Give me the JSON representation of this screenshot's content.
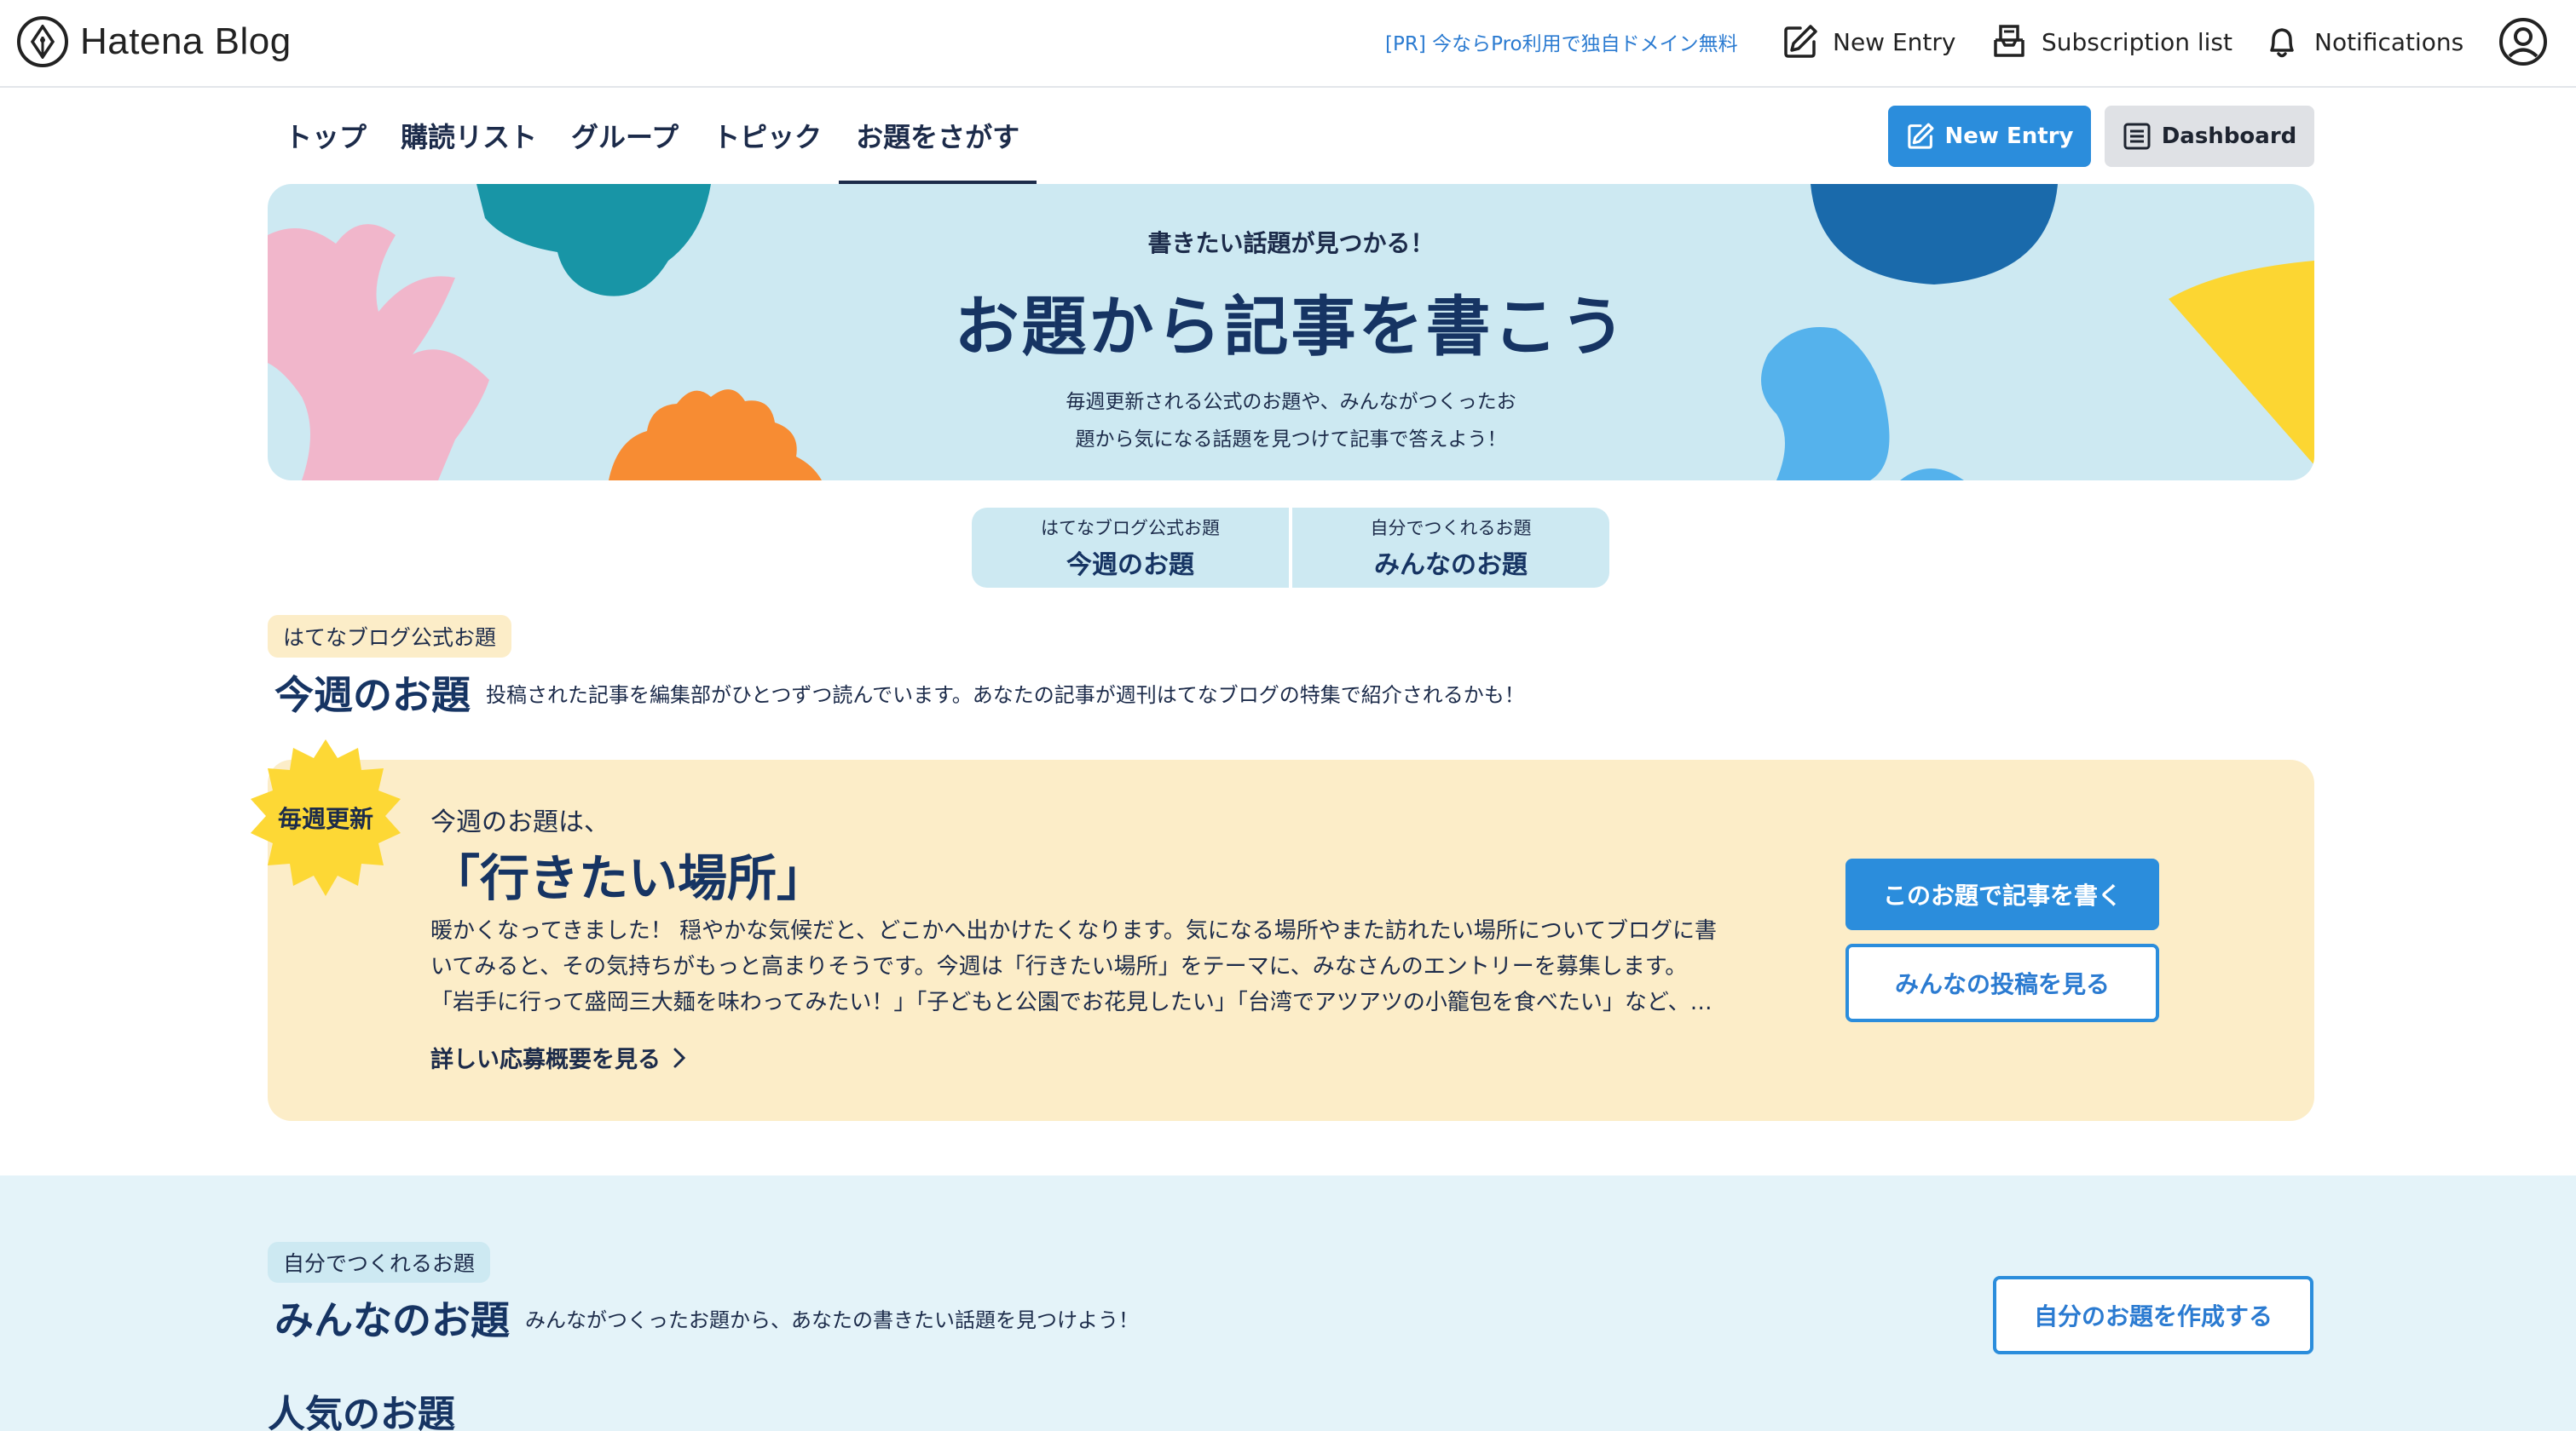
{
  "header": {
    "logo_text": "Hatena Blog",
    "pr_link": "[PR] 今ならPro利用で独自ドメイン無料",
    "new_entry": "New Entry",
    "subscription_list": "Subscription list",
    "notifications": "Notifications"
  },
  "subnav": {
    "tabs": [
      {
        "label": "トップ",
        "active": false
      },
      {
        "label": "購読リスト",
        "active": false
      },
      {
        "label": "グループ",
        "active": false
      },
      {
        "label": "トピック",
        "active": false
      },
      {
        "label": "お題をさがす",
        "active": true
      }
    ],
    "new_entry_button": "New Entry",
    "dashboard_button": "Dashboard"
  },
  "hero": {
    "subtitle": "書きたい話題が見つかる！",
    "title": "お題から記事を書こう",
    "desc_line1": "毎週更新される公式のお題や、みんながつくったお",
    "desc_line2": "題から気になる話題を見つけて記事で答えよう！"
  },
  "toggle": {
    "official": {
      "small": "はてなブログ公式お題",
      "big": "今週のお題"
    },
    "everyone": {
      "small": "自分でつくれるお題",
      "big": "みんなのお題"
    }
  },
  "weekly": {
    "badge": "はてなブログ公式お題",
    "title": "今週のお題",
    "desc": "投稿された記事を編集部がひとつずつ読んでいます。あなたの記事が週刊はてなブログの特集で紹介されるかも！",
    "burst_label": "毎週更新",
    "lead": "今週のお題は、",
    "theme": "「行きたい場所」",
    "body_line1": "暖かくなってきました！ 穏やかな気候だと、どこかへ出かけたくなります。気になる場所やまた訪れたい場所についてブログに書",
    "body_line2": "いてみると、その気持ちがもっと高まりそうです。今週は「行きたい場所」をテーマに、みなさんのエントリーを募集します。",
    "body_line3": "「岩手に行って盛岡三大麺を味わってみたい！」「子どもと公園でお花見したい」「台湾でアツアツの小籠包を食べたい」など、…",
    "more_link": "詳しい応募概要を見る",
    "write_button": "このお題で記事を書く",
    "view_button": "みんなの投稿を見る"
  },
  "everyone": {
    "badge": "自分でつくれるお題",
    "title": "みんなのお題",
    "desc": "みんながつくったお題から、あなたの書きたい話題を見つけよう！",
    "create_button": "自分のお題を作成する",
    "popular_heading": "人気のお題"
  },
  "colors": {
    "accent_blue": "#2b8ddc",
    "navy": "#163463",
    "hero_bg": "#cde9f2",
    "weekly_bg": "#fcedc8",
    "burst_yellow": "#fdd835",
    "everyone_bg": "#e4f3f9"
  }
}
